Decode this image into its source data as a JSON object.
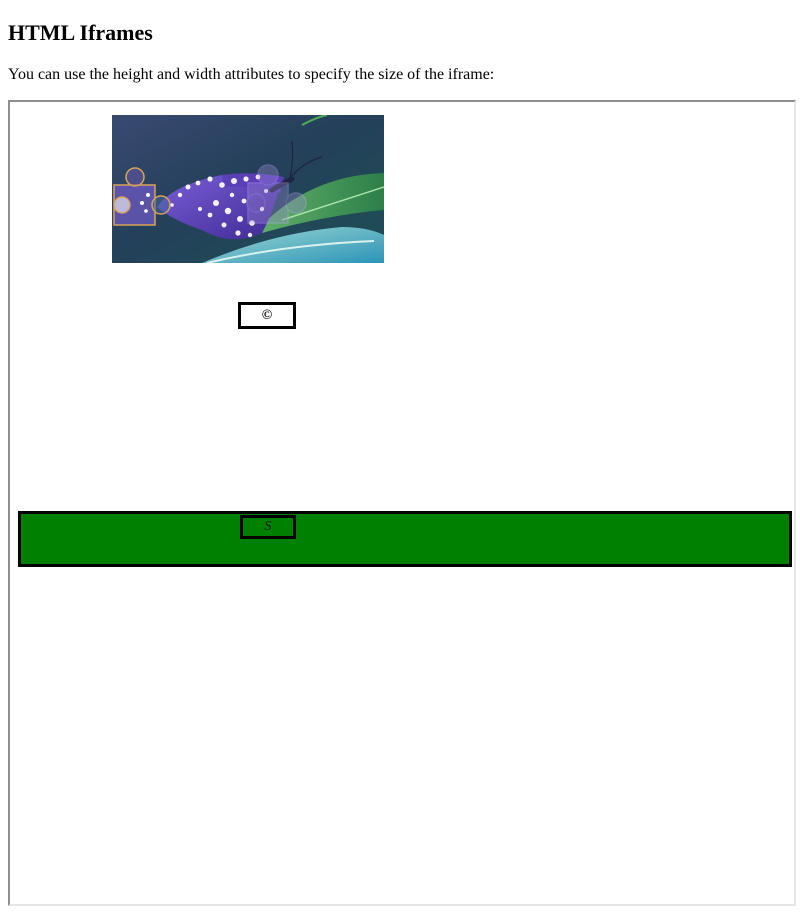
{
  "page": {
    "title": "HTML Iframes",
    "description": "You can use the height and width attributes to specify the size of the iframe:"
  },
  "iframe": {
    "image": {
      "subject": "purple butterfly on green leaf",
      "overlay_icons": [
        "puzzle-piece-icon",
        "puzzle-piece-icon"
      ]
    },
    "top_box": {
      "symbol": "©"
    },
    "green_bar": {
      "color": "#008000",
      "symbol": "S"
    }
  }
}
